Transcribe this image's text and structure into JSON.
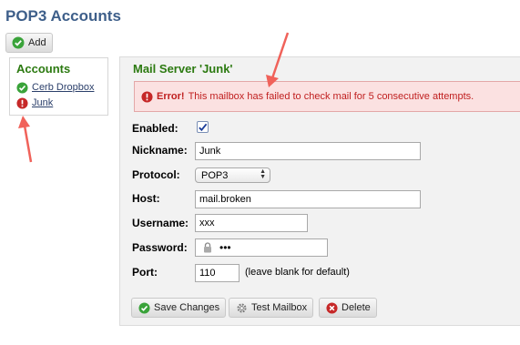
{
  "page": {
    "title": "POP3 Accounts"
  },
  "toolbar": {
    "add_label": "Add"
  },
  "accounts": {
    "heading": "Accounts",
    "items": [
      {
        "label": "Cerb Dropbox",
        "status": "ok"
      },
      {
        "label": "Junk",
        "status": "error"
      }
    ]
  },
  "server": {
    "title": "Mail Server 'Junk'",
    "error": {
      "prefix": "Error!",
      "message": "This mailbox has failed to check mail for 5 consecutive attempts."
    },
    "fields": {
      "enabled_label": "Enabled:",
      "enabled": true,
      "nickname_label": "Nickname:",
      "nickname_value": "Junk",
      "protocol_label": "Protocol:",
      "protocol_value": "POP3",
      "host_label": "Host:",
      "host_value": "mail.broken",
      "username_label": "Username:",
      "username_value": "xxx",
      "password_label": "Password:",
      "password_mask": "•••",
      "port_label": "Port:",
      "port_value": "110",
      "port_hint": "(leave blank for default)"
    },
    "buttons": {
      "save_label": "Save Changes",
      "test_label": "Test Mailbox",
      "delete_label": "Delete"
    }
  },
  "colors": {
    "title_blue": "#3e5f8a",
    "heading_green": "#2c7a11",
    "error_red": "#c02020",
    "arrow_red": "#f0625a"
  },
  "icons": [
    "check-circle-icon",
    "error-circle-icon",
    "gear-icon",
    "delete-circle-icon",
    "lock-icon",
    "checkmark-icon"
  ]
}
